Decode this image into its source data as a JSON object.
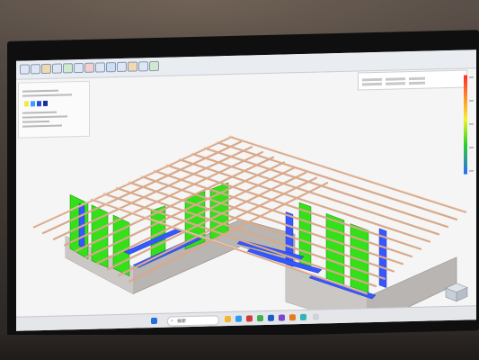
{
  "scene": {
    "search_glyph": "⌕",
    "search_text": "検索",
    "accent_colors": {
      "beam": "#e6bfa4",
      "floor_beam": "#3557ff",
      "wall_panel": "#33e019",
      "foundation": "#b8b5b2"
    },
    "icons": [
      "search-icon",
      "start-icon",
      "browser-icon",
      "folder-icon",
      "mail-icon"
    ]
  }
}
